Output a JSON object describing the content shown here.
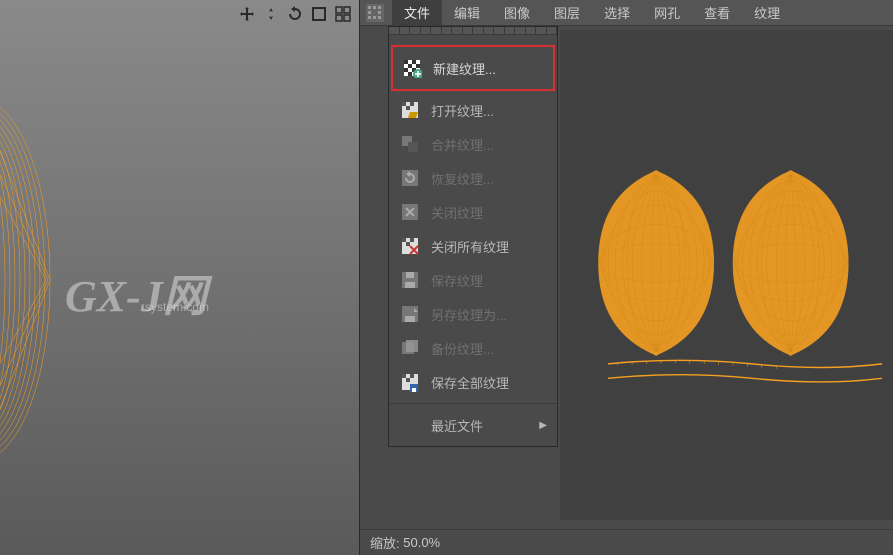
{
  "menu": {
    "items": [
      "文件",
      "编辑",
      "图像",
      "图层",
      "选择",
      "网孔",
      "查看",
      "纹理"
    ],
    "active_index": 0
  },
  "dropdown": {
    "items": [
      {
        "label": "新建纹理...",
        "icon": "new-texture-icon",
        "highlighted": true,
        "disabled": false
      },
      {
        "label": "打开纹理...",
        "icon": "open-texture-icon",
        "highlighted": false,
        "disabled": false
      },
      {
        "label": "合并纹理...",
        "icon": "merge-texture-icon",
        "highlighted": false,
        "disabled": true
      },
      {
        "label": "恢复纹理...",
        "icon": "restore-texture-icon",
        "highlighted": false,
        "disabled": true
      },
      {
        "label": "关闭纹理",
        "icon": "close-texture-icon",
        "highlighted": false,
        "disabled": true
      },
      {
        "label": "关闭所有纹理",
        "icon": "close-all-icon",
        "highlighted": false,
        "disabled": false
      },
      {
        "label": "保存纹理",
        "icon": "save-texture-icon",
        "highlighted": false,
        "disabled": true
      },
      {
        "label": "另存纹理为...",
        "icon": "save-as-icon",
        "highlighted": false,
        "disabled": true
      },
      {
        "label": "备份纹理...",
        "icon": "backup-texture-icon",
        "highlighted": false,
        "disabled": true
      },
      {
        "label": "保存全部纹理",
        "icon": "save-all-icon",
        "highlighted": false,
        "disabled": false
      },
      {
        "label": "最近文件",
        "icon": "recent-files-icon",
        "highlighted": false,
        "disabled": false,
        "separator_before": true,
        "has_submenu": true
      }
    ]
  },
  "status": {
    "zoom_label": "缩放:",
    "zoom_value": "50.0%"
  },
  "watermark": {
    "main": "GX-J网",
    "sub": "system.com"
  },
  "colors": {
    "uv_mesh": "#f5a020",
    "highlight_border": "#d83030"
  }
}
